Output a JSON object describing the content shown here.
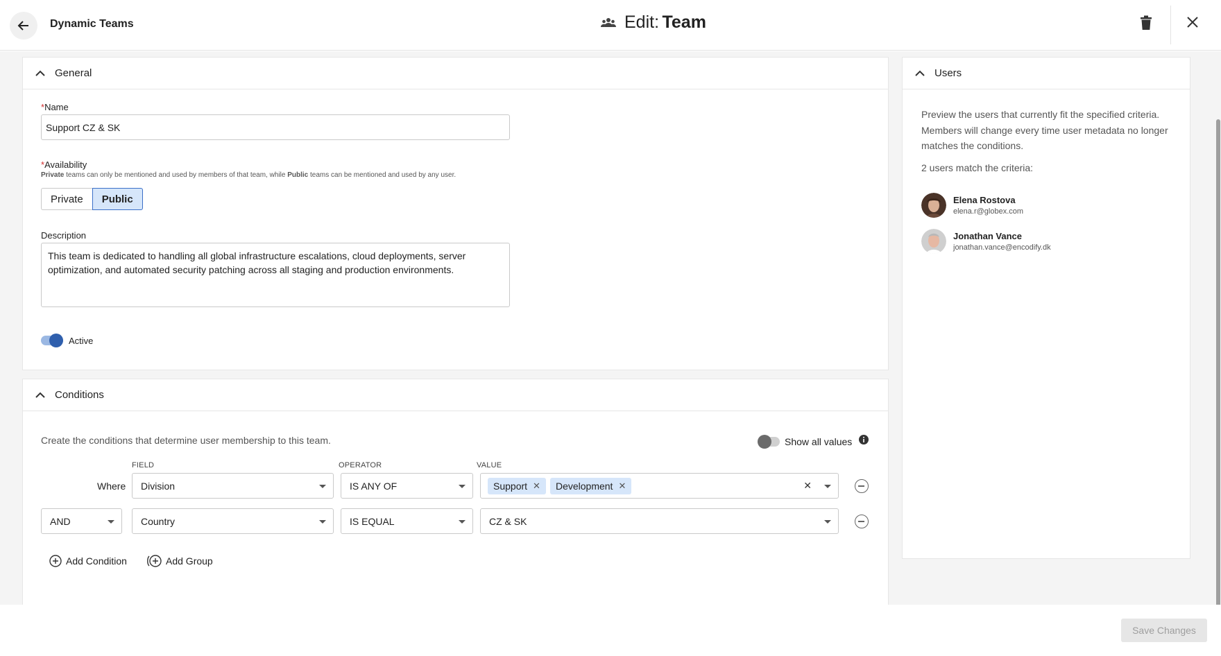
{
  "header": {
    "breadcrumb": "Dynamic Teams",
    "title_prefix": "Edit:",
    "title_name": "Team"
  },
  "general": {
    "section_title": "General",
    "name_label": "Name",
    "name_value": "Support CZ & SK",
    "availability_label": "Availability",
    "availability_hint": {
      "private_word": "Private",
      "mid_text": " teams can only be mentioned and used by members of that team, while ",
      "public_word": "Public",
      "end_text": " teams can be mentioned and used by any user."
    },
    "availability_options": [
      "Private",
      "Public"
    ],
    "availability_selected": "Public",
    "description_label": "Description",
    "description_value": "This team is dedicated to handling all global infrastructure escalations, cloud deployments, server optimization, and automated security patching across all staging and production environments.",
    "active_label": "Active",
    "active_on": true
  },
  "conditions": {
    "section_title": "Conditions",
    "intro": "Create the conditions that determine user membership to this team.",
    "show_all_label": "Show all values",
    "show_all_on": false,
    "col_field": "FIELD",
    "col_operator": "OPERATOR",
    "col_value": "VALUE",
    "row1": {
      "connector": "Where",
      "field": "Division",
      "operator": "IS ANY OF",
      "values": [
        "Support",
        "Development"
      ]
    },
    "row2": {
      "connector": "AND",
      "field": "Country",
      "operator": "IS EQUAL",
      "value": "CZ & SK"
    },
    "add_condition": "Add Condition",
    "add_group": "Add Group"
  },
  "users": {
    "section_title": "Users",
    "preview_text": "Preview the users that currently fit the specified criteria. Members will change every time user metadata no longer matches the conditions.",
    "match_text": "2 users match the criteria:",
    "list": [
      {
        "name": "Elena Rostova",
        "email": "elena.r@globex.com"
      },
      {
        "name": "Jonathan Vance",
        "email": "jonathan.vance@encodify.dk"
      }
    ]
  },
  "footer": {
    "save_label": "Save Changes"
  },
  "colors": {
    "accent": "#2f5fad",
    "selected_bg": "#d6e6fa",
    "required": "#d32f2f"
  }
}
